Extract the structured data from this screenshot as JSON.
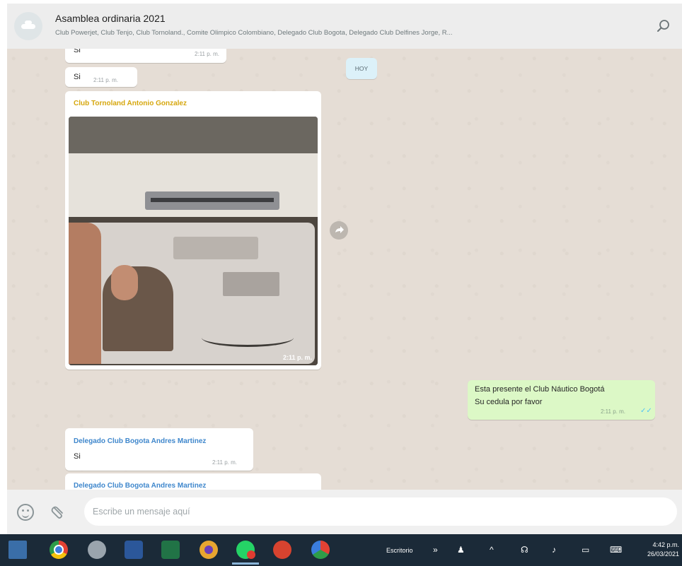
{
  "header": {
    "title": "Asamblea ordinaria 2021",
    "members": "Club Powerjet, Club Tenjo, Club Tornoland., Comite Olimpico Colombiano, Delegado Club Bogota, Delegado Club Delfines Jorge, R...",
    "icons": [
      "group-avatar",
      "search-icon"
    ]
  },
  "chat": {
    "date_label": "HOY",
    "messages": [
      {
        "text": "Si",
        "time": "2:11 p. m."
      },
      {
        "text": "Si",
        "time": "2:11 p. m."
      },
      {
        "sender": "Club Tornoland Antonio Gonzalez",
        "sender_color": "#d6a70e",
        "type": "image",
        "time": "2:11 p. m."
      },
      {
        "outgoing": true,
        "lines": [
          "Esta presente el Club Náutico Bogotá",
          "Su cedula por favor"
        ],
        "time": "2:11 p. m.",
        "status_icon": "double-check-icon"
      },
      {
        "sender": "Delegado Club Bogota Andres Martinez",
        "sender_color": "#3f87cc",
        "text": "Si",
        "time": "2:11 p. m."
      },
      {
        "sender": "Delegado Club Bogota Andres Martinez",
        "sender_color": "#3f87cc"
      }
    ]
  },
  "composer": {
    "placeholder": "Escribe un mensaje aquí",
    "icons": [
      "emoji-icon",
      "paperclip-icon"
    ]
  },
  "taskbar": {
    "apps": [
      "file-explorer-icon",
      "chrome-icon",
      "app-icon",
      "word-icon",
      "excel-icon",
      "app-icon",
      "whatsapp-icon",
      "app-icon",
      "chrome-icon"
    ],
    "desktop_label": "Escritorio",
    "time": "4:42 p.m.",
    "date": "26/03/2021"
  }
}
